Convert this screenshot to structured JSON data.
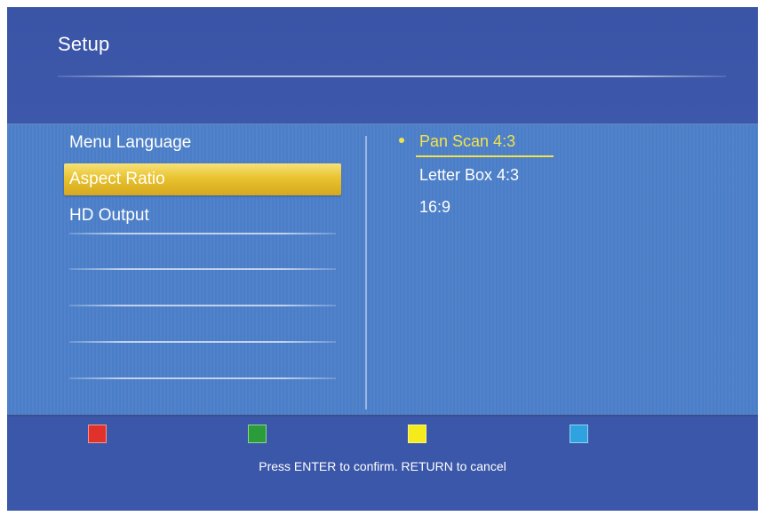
{
  "header": {
    "title": "Setup"
  },
  "menu": {
    "items": [
      {
        "label": "Menu Language",
        "selected": false
      },
      {
        "label": "Aspect Ratio",
        "selected": true
      },
      {
        "label": "HD Output",
        "selected": false
      }
    ]
  },
  "options": {
    "items": [
      {
        "label": "Pan Scan 4:3",
        "active": true
      },
      {
        "label": "Letter Box 4:3",
        "active": false
      },
      {
        "label": "16:9",
        "active": false
      }
    ]
  },
  "footer": {
    "keys": [
      {
        "name": "red",
        "color": "#e0322a"
      },
      {
        "name": "green",
        "color": "#2a9c3a"
      },
      {
        "name": "yellow",
        "color": "#f5ea1c"
      },
      {
        "name": "blue",
        "color": "#2fa3e0"
      }
    ],
    "hint": "Press ENTER to confirm. RETURN to cancel"
  },
  "colors": {
    "highlight": "#e9c330",
    "active_text": "#f2e24a",
    "background": "#4b7ec8"
  }
}
